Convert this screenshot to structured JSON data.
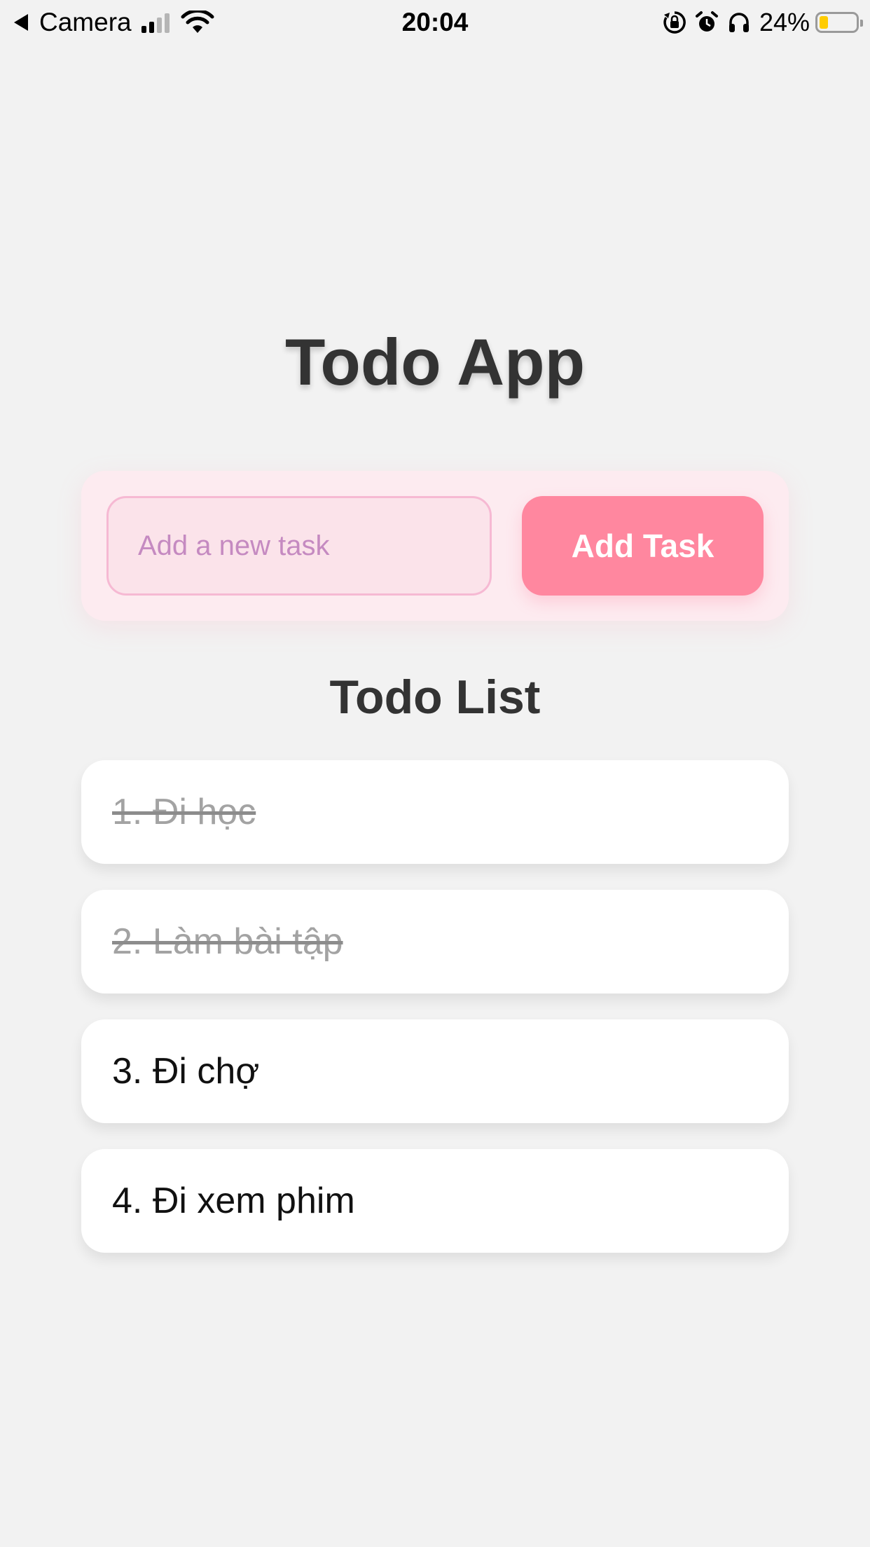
{
  "status_bar": {
    "back_label": "Camera",
    "time": "20:04",
    "battery_percent": "24%",
    "battery_level": 0.24,
    "icons": [
      "back-arrow-icon",
      "cellular-signal-icon",
      "wifi-icon",
      "orientation-lock-icon",
      "alarm-icon",
      "headphones-icon",
      "battery-icon"
    ]
  },
  "app": {
    "title": "Todo App",
    "input": {
      "placeholder": "Add a new task",
      "value": ""
    },
    "add_button_label": "Add Task",
    "list_title": "Todo List",
    "todos": [
      {
        "text": "1. Đi học",
        "completed": true
      },
      {
        "text": "2. Làm bài tập",
        "completed": true
      },
      {
        "text": "3. Đi chợ",
        "completed": false
      },
      {
        "text": "4. Đi xem phim",
        "completed": false
      }
    ]
  },
  "colors": {
    "background": "#f2f2f2",
    "panel": "#fdebf0",
    "input_border": "#f6b9d3",
    "placeholder": "#c58ac1",
    "button": "#ff879f",
    "completed_text": "#a3a3a3"
  }
}
